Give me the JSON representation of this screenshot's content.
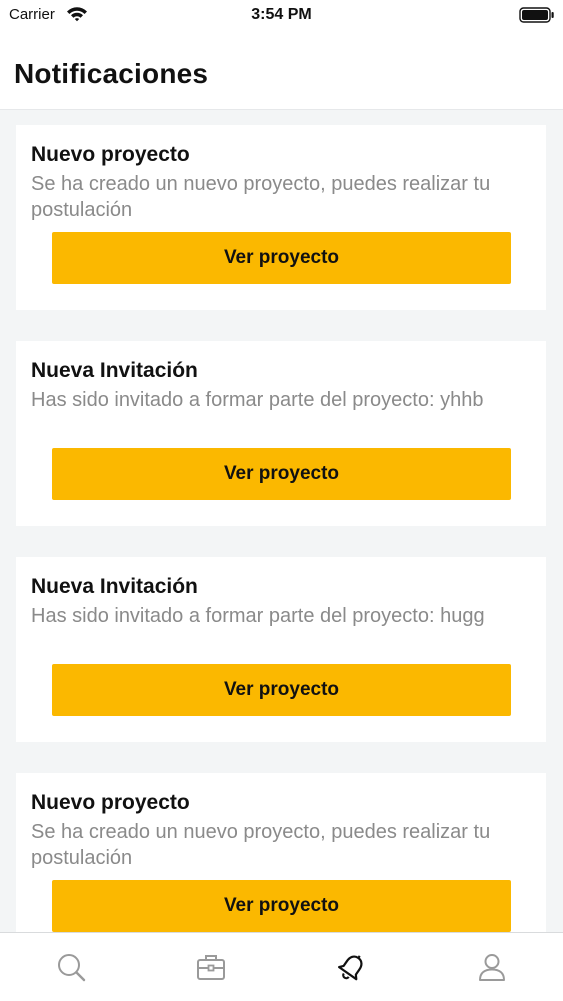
{
  "status_bar": {
    "carrier": "Carrier",
    "time": "3:54 PM",
    "icons": [
      "wifi-icon",
      "battery-icon"
    ]
  },
  "header": {
    "title": "Notificaciones"
  },
  "notifications": [
    {
      "title": "Nuevo proyecto",
      "message": "Se ha creado un nuevo proyecto, puedes realizar tu postulación",
      "button_label": "Ver proyecto"
    },
    {
      "title": "Nueva Invitación",
      "message": "Has sido invitado a formar parte del proyecto:  yhhb",
      "button_label": "Ver proyecto"
    },
    {
      "title": "Nueva Invitación",
      "message": "Has sido invitado a formar parte del proyecto:  hugg",
      "button_label": "Ver proyecto"
    },
    {
      "title": "Nuevo proyecto",
      "message": "Se ha creado un nuevo proyecto, puedes realizar tu postulación",
      "button_label": "Ver proyecto"
    }
  ],
  "tab_bar": {
    "tabs": [
      {
        "icon": "search-icon",
        "active": false
      },
      {
        "icon": "briefcase-icon",
        "active": false
      },
      {
        "icon": "bell-icon",
        "active": true
      },
      {
        "icon": "user-icon",
        "active": false
      }
    ]
  },
  "colors": {
    "accent": "#fbb800",
    "background": "#f3f5f6",
    "card": "#ffffff",
    "message_text": "#8a8a8a",
    "tab_inactive": "#9a9a9a",
    "tab_active": "#111111"
  }
}
